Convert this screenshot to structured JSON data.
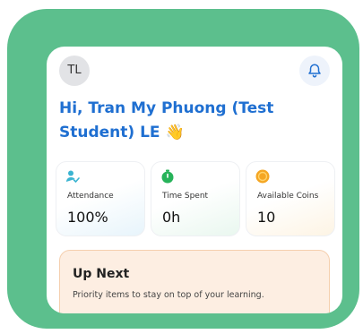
{
  "header": {
    "avatar_initials": "TL",
    "bell_icon": "bell-icon"
  },
  "greeting": {
    "text": "Hi, Tran My Phuong (Test Student) LE",
    "emoji": "👋"
  },
  "stats": [
    {
      "label": "Attendance",
      "value": "100%",
      "icon": "user-check-icon",
      "color": "#3bb4d1"
    },
    {
      "label": "Time Spent",
      "value": "0h",
      "icon": "stopwatch-icon",
      "color": "#27b35a"
    },
    {
      "label": "Available Coins",
      "value": "10",
      "icon": "coin-icon",
      "color": "#f5a623"
    }
  ],
  "up_next": {
    "title": "Up Next",
    "subtitle": "Priority items to stay on top of your learning."
  },
  "colors": {
    "frame": "#5cbf8d",
    "greeting": "#1f6fd1",
    "bell": "#1f6fd1",
    "up_next_bg": "#fdeee2"
  }
}
